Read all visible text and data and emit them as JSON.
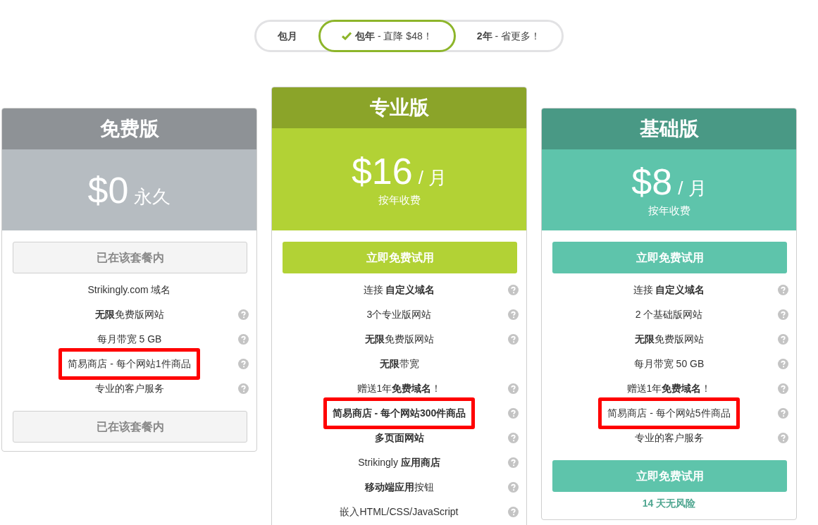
{
  "billing_tabs": [
    {
      "label": "**包月**",
      "selected": false
    },
    {
      "label": "**包年** - 直降 $48！",
      "selected": true
    },
    {
      "label": "**2年** - 省更多！",
      "selected": false
    }
  ],
  "plans": [
    {
      "name": "免费版",
      "color": "#b6bcc1",
      "featured": false,
      "price": "$0",
      "period": "永久",
      "top_button": {
        "label": "已在该套餐内",
        "disabled": true
      },
      "features": [
        {
          "text": "Strikingly.com 域名",
          "help": false,
          "highlighted": false
        },
        {
          "text": "**无限**免费版网站",
          "help": true,
          "highlighted": false
        },
        {
          "text": "每月带宽 5 GB",
          "help": true,
          "highlighted": false
        },
        {
          "text": "简易商店 - 每个网站1件商品",
          "help": true,
          "highlighted": true
        },
        {
          "text": "专业的客户服务",
          "help": true,
          "highlighted": false
        }
      ],
      "bottom_button": {
        "label": "已在该套餐内",
        "disabled": true
      }
    },
    {
      "name": "专业版",
      "color": "#b2d235",
      "featured": true,
      "price": "$16",
      "period": "/ 月",
      "billing_note": "按年收费",
      "top_button": {
        "label": "立即免费试用",
        "disabled": false
      },
      "features": [
        {
          "text": "连接 **自定义域名**",
          "help": true,
          "highlighted": false
        },
        {
          "text": "3个专业版网站",
          "help": true,
          "highlighted": false
        },
        {
          "text": "**无限**免费版网站",
          "help": true,
          "highlighted": false
        },
        {
          "text": "**无限**带宽",
          "help": false,
          "highlighted": false
        },
        {
          "text": "赠送1年**免费域名**！",
          "help": true,
          "highlighted": false
        },
        {
          "text": "**简易商店 - 每个网站300件商品**",
          "help": true,
          "highlighted": true
        },
        {
          "text": "**多页面网站**",
          "help": true,
          "highlighted": false
        },
        {
          "text": "Strikingly **应用商店**",
          "help": true,
          "highlighted": false
        },
        {
          "text": "**移动端应用**按钮",
          "help": true,
          "highlighted": false
        },
        {
          "text": "嵌入HTML/CSS/JavaScript",
          "help": true,
          "highlighted": false
        }
      ]
    },
    {
      "name": "基础版",
      "color": "#5ec4ab",
      "featured": false,
      "price": "$8",
      "period": "/ 月",
      "billing_note": "按年收费",
      "top_button": {
        "label": "立即免费试用",
        "disabled": false
      },
      "features": [
        {
          "text": "连接 **自定义域名**",
          "help": true,
          "highlighted": false
        },
        {
          "text": "2 个基础版网站",
          "help": true,
          "highlighted": false
        },
        {
          "text": "**无限**免费版网站",
          "help": true,
          "highlighted": false
        },
        {
          "text": "每月带宽 50 GB",
          "help": true,
          "highlighted": false
        },
        {
          "text": "赠送1年**免费域名**！",
          "help": true,
          "highlighted": false
        },
        {
          "text": "简易商店 - 每个网站5件商品",
          "help": true,
          "highlighted": true
        },
        {
          "text": "专业的客户服务",
          "help": true,
          "highlighted": false
        }
      ],
      "bottom_button": {
        "label": "立即免费试用",
        "disabled": false
      },
      "footnote": "14 天无风险"
    }
  ]
}
